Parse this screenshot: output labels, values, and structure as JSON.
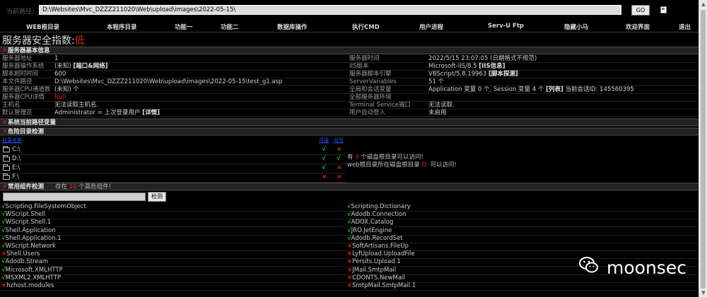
{
  "pathbar": {
    "label": "当前路径:",
    "path": "D:\\Websites\\Mvc_DZZZ211020\\Web\\upload\\images\\2022-05-15\\",
    "go": "GO"
  },
  "menu": [
    "WEB根目录",
    "本程序目录",
    "功能一",
    "功能二",
    "数据库操作",
    "执行CMD",
    "用户进程",
    "Serv-U Ftp",
    "隐藏小马",
    "欢迎界面",
    "退出"
  ],
  "security": {
    "label": "服务器安全指数:",
    "level": "低"
  },
  "basic": {
    "title": "服务器基本信息",
    "left": [
      {
        "k": "服务器地址",
        "v": "1"
      },
      {
        "k": "服务器操作系统",
        "v": "(未知)",
        "link": "[端口&网络]"
      },
      {
        "k": "脚本超时时间",
        "v": "600"
      },
      {
        "k": "本文件路径",
        "v": "D:\\Websites\\Mvc_DZZZ211020\\Web\\upload\\images\\2022-05-15\\test_g1.asp"
      },
      {
        "k": "服务器CPU通道数",
        "v": "(未知) 个"
      },
      {
        "k": "服务器CPU详情",
        "v": "Null"
      },
      {
        "k": "主机名",
        "v": "无法读取主机名."
      },
      {
        "k": "默认管理员",
        "v": "Administrator = 上次登录用户",
        "link": "[详情]"
      }
    ],
    "right": [
      {
        "k": "服务器时间",
        "v": "2022/5/15 23:07:05 (日期格式不规范)"
      },
      {
        "k": "IIS版本",
        "v": "Microsoft-IIS/8.5",
        "link": "[IIS信息]"
      },
      {
        "k": "服务器脚本引擎",
        "v": "VBScript/5.8.19963",
        "link": "[脚本探测]"
      },
      {
        "k": "ServerVariables",
        "v": "51 个"
      },
      {
        "k": "全局和会话变量",
        "v": "Application 变量 0 个, Session 变量 4 个",
        "link": "[列表]",
        "extra": "当前会话ID: 145560395"
      },
      {
        "k": "全部服务器环境",
        "v": ""
      },
      {
        "k": "Terminal Service端口",
        "v": "无法读取."
      },
      {
        "k": "用户自动登入",
        "v": "未启用"
      }
    ]
  },
  "pathvar": {
    "title": "系统当前路径变量"
  },
  "danger": {
    "title": "危险目录检测",
    "headers": [
      "目录名称",
      "可读",
      "可写"
    ],
    "rows": [
      {
        "name": "C:\\",
        "read": "√",
        "write": "×"
      },
      {
        "name": "D:\\",
        "read": "√",
        "write": "√"
      },
      {
        "name": "E:\\",
        "read": "√",
        "write": "×"
      },
      {
        "name": "F:\\",
        "read": "×",
        "write": "×"
      }
    ],
    "summary1_a": "有 ",
    "summary1_n": "3",
    "summary1_b": " 个磁盘根目录可以访问!",
    "summary2_a": "web根目录所在磁盘根目录 ",
    "summary2_d": "D:",
    "summary2_b": " 可以访问!"
  },
  "components": {
    "title": "常用组件检测",
    "note_a": "存在 ",
    "note_n": "10",
    "note_b": " 个高危组件!",
    "button": "检测",
    "left": [
      {
        "m": "√",
        "name": "Scripting.FileSystemObject"
      },
      {
        "m": "√",
        "name": "WScript.Shell"
      },
      {
        "m": "√",
        "name": "WScript.Shell.1"
      },
      {
        "m": "√",
        "name": "Shell.Application"
      },
      {
        "m": "√",
        "name": "Shell.Application.1"
      },
      {
        "m": "√",
        "name": "WScript.Network"
      },
      {
        "m": "×",
        "name": "Shell.Users"
      },
      {
        "m": "√",
        "name": "Adodb.Stream"
      },
      {
        "m": "√",
        "name": "Microsoft.XMLHTTP"
      },
      {
        "m": "√",
        "name": "MSXML2.XMLHTTP"
      },
      {
        "m": "×",
        "name": "hzhost.modules"
      }
    ],
    "right": [
      {
        "m": "√",
        "name": "Scripting.Dictionary"
      },
      {
        "m": "√",
        "name": "Adodb.Connection"
      },
      {
        "m": "√",
        "name": "ADOX.Catalog"
      },
      {
        "m": "√",
        "name": "JRO.JetEngine"
      },
      {
        "m": "√",
        "name": "Adodb.RecordSet"
      },
      {
        "m": "×",
        "name": "SoftArtisans.FileUp"
      },
      {
        "m": "×",
        "name": "LyfUpload.UploadFile"
      },
      {
        "m": "×",
        "name": "Persits.Upload.1"
      },
      {
        "m": "×",
        "name": "JMail.SmtpMail"
      },
      {
        "m": "×",
        "name": "CDONTS.NewMail"
      },
      {
        "m": "×",
        "name": "SmtpMail.SmtpMail.1"
      }
    ]
  },
  "watermark": {
    "text": "moonsec",
    "icon": "wechat-icon"
  },
  "colors": {
    "danger": "#e02020",
    "ok": "#24c224",
    "link": "#3355ff"
  }
}
